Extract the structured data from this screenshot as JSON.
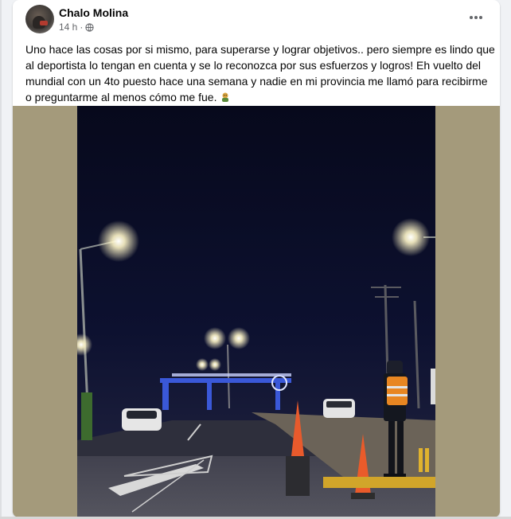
{
  "post": {
    "author": "Chalo Molina",
    "timestamp": "14 h",
    "privacy_icon": "globe-icon",
    "more_icon": "more-options-icon",
    "text": "Uno hace las cosas por si mismo, para superarse y lograr objetivos.. pero siempre es lindo que al deportista lo tengan en cuenta y se lo reconozca por sus esfuerzos y logros! Eh vuelto del mundial con un 4to puesto hace una semana y nadie en mi provincia me llamó para recibirme o preguntarme al menos cómo me fue.",
    "emoji_icon": "face-emoji-icon"
  },
  "colors": {
    "page_background": "#f0f2f5",
    "card_background": "#ffffff",
    "text_primary": "#050505",
    "text_secondary": "#65676b",
    "photo_side_fill": "#a49a7b",
    "night_sky": "#0b0f2a"
  }
}
